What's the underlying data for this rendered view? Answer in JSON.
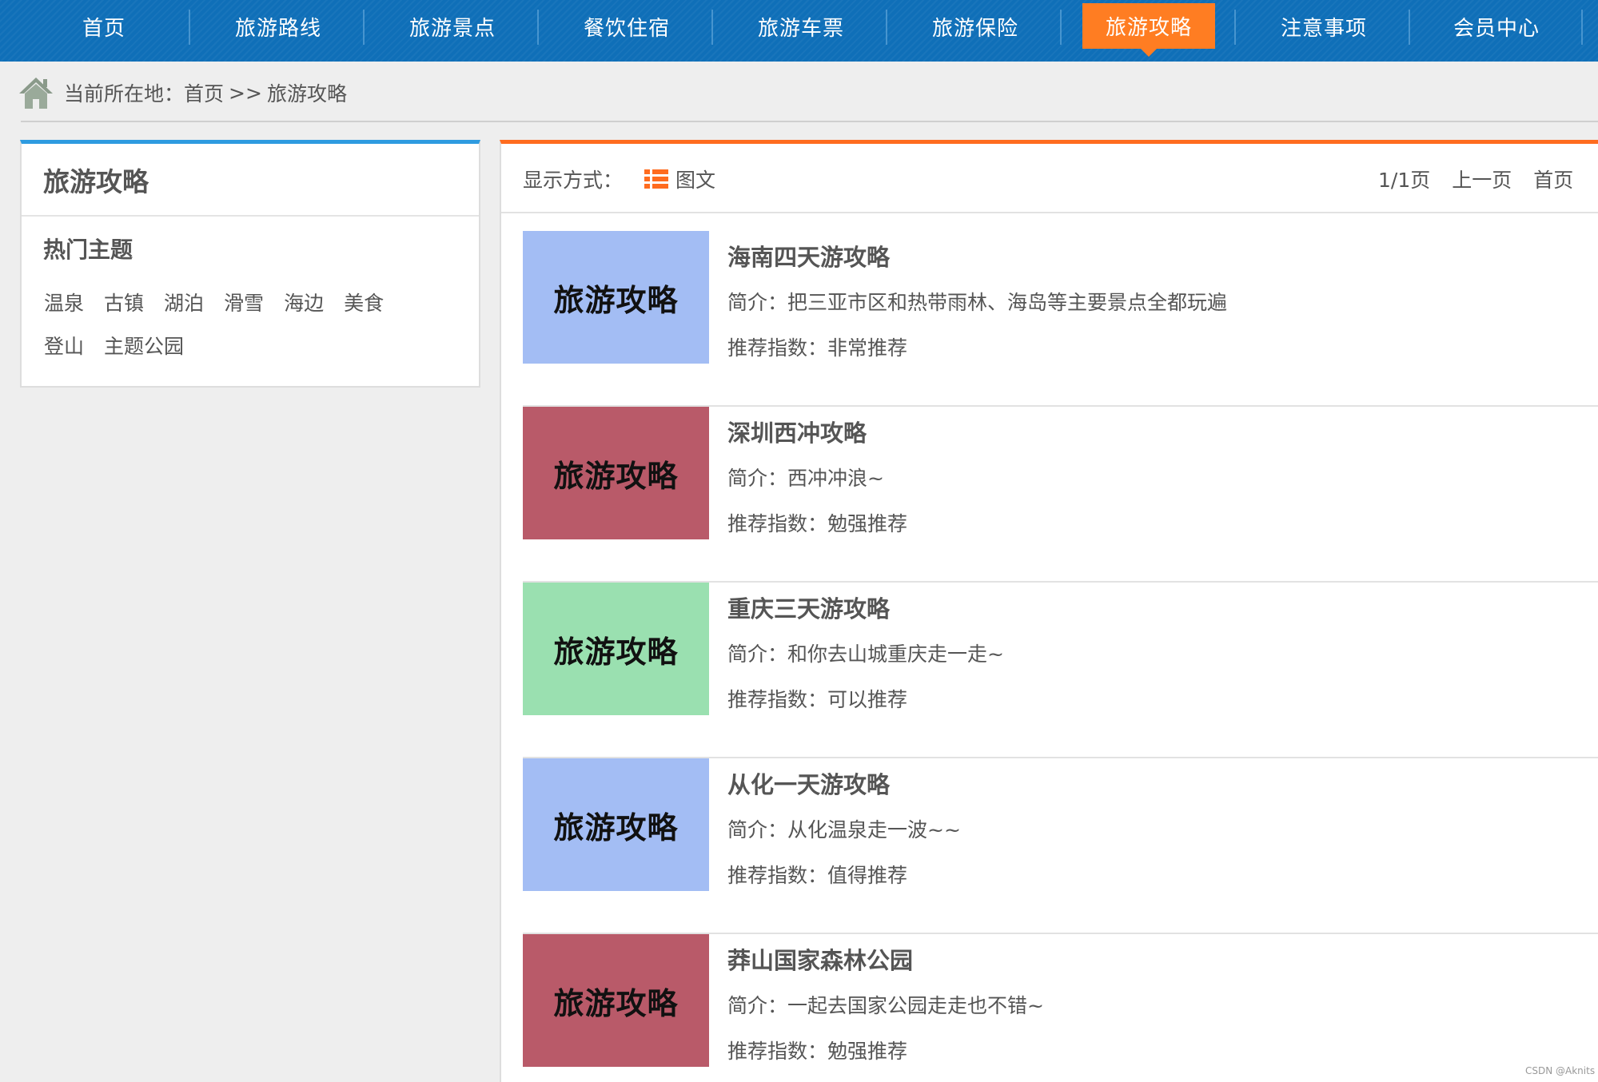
{
  "nav": {
    "items": [
      {
        "label": "首页"
      },
      {
        "label": "旅游路线"
      },
      {
        "label": "旅游景点"
      },
      {
        "label": "餐饮住宿"
      },
      {
        "label": "旅游车票"
      },
      {
        "label": "旅游保险"
      },
      {
        "label": "旅游攻略"
      },
      {
        "label": "注意事项"
      },
      {
        "label": "会员中心"
      }
    ],
    "active_index": 6
  },
  "breadcrumb": {
    "prefix": "当前所在地：",
    "home": "首页",
    "separator": ">>",
    "current": "旅游攻略"
  },
  "sidebar": {
    "title": "旅游攻略",
    "subtitle": "热门主题",
    "tags": [
      "温泉",
      "古镇",
      "湖泊",
      "滑雪",
      "海边",
      "美食",
      "登山",
      "主题公园"
    ]
  },
  "toolbar": {
    "display_label": "显示方式：",
    "display_mode": "图文",
    "page_info": "1/1页",
    "prev": "上一页",
    "first": "首页"
  },
  "articles": [
    {
      "thumb_text": "旅游攻略",
      "thumb_color": "#a3bdf4",
      "title": "海南四天游攻略",
      "intro": "简介：把三亚市区和热带雨林、海岛等主要景点全都玩遍",
      "rec": "推荐指数：非常推荐"
    },
    {
      "thumb_text": "旅游攻略",
      "thumb_color": "#b95a69",
      "title": "深圳西冲攻略",
      "intro": "简介：西冲冲浪~",
      "rec": "推荐指数：勉强推荐"
    },
    {
      "thumb_text": "旅游攻略",
      "thumb_color": "#9ae0b0",
      "title": "重庆三天游攻略",
      "intro": "简介：和你去山城重庆走一走~",
      "rec": "推荐指数：可以推荐"
    },
    {
      "thumb_text": "旅游攻略",
      "thumb_color": "#a3bdf4",
      "title": "从化一天游攻略",
      "intro": "简介：从化温泉走一波~~",
      "rec": "推荐指数：值得推荐"
    },
    {
      "thumb_text": "旅游攻略",
      "thumb_color": "#b95a69",
      "title": "莽山国家森林公园",
      "intro": "简介：一起去国家公园走走也不错~",
      "rec": "推荐指数：勉强推荐"
    }
  ],
  "colors": {
    "nav_bg": "#0f6fb8",
    "nav_active": "#ff7d22",
    "sidebar_accent": "#2e9be0",
    "main_accent": "#ff6c1f"
  },
  "watermark": "CSDN @Aknits"
}
